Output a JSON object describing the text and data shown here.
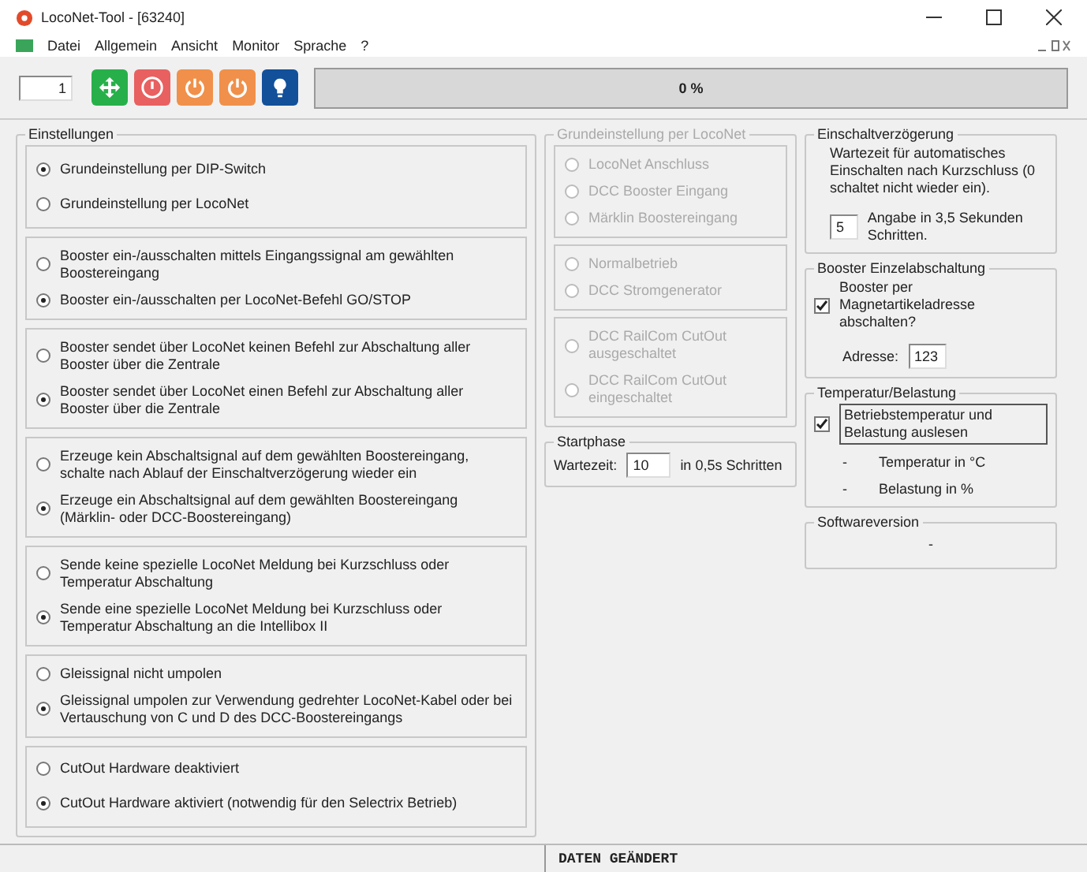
{
  "window": {
    "title": "LocoNet-Tool - [63240]"
  },
  "menu": [
    "Datei",
    "Allgemein",
    "Ansicht",
    "Monitor",
    "Sprache",
    "?"
  ],
  "toolbar": {
    "address": "1",
    "buttons": [
      {
        "kind": "connect"
      },
      {
        "kind": "stop"
      },
      {
        "kind": "power"
      },
      {
        "kind": "power"
      },
      {
        "kind": "light"
      }
    ],
    "progress": {
      "label": "0 %",
      "level": 0
    }
  },
  "settings": {
    "title": "Einstellungen",
    "groups": [
      {
        "options": [
          {
            "label": "Grundeinstellung per DIP-Switch",
            "selected": true
          },
          {
            "label": "Grundeinstellung per LocoNet",
            "selected": false
          }
        ]
      },
      {
        "options": [
          {
            "label": "Booster ein-/ausschalten mittels Eingangssignal am gewählten Boostereingang",
            "selected": false
          },
          {
            "label": "Booster ein-/ausschalten per LocoNet-Befehl GO/STOP",
            "selected": true
          }
        ]
      },
      {
        "options": [
          {
            "label": "Booster sendet über LocoNet keinen Befehl zur Abschaltung aller Booster über die Zentrale",
            "selected": false
          },
          {
            "label": "Booster sendet über LocoNet einen Befehl zur Abschaltung aller Booster über die Zentrale",
            "selected": true
          }
        ]
      },
      {
        "options": [
          {
            "label": "Erzeuge kein Abschaltsignal auf dem gewählten Boostereingang, schalte nach Ablauf der Einschaltverzögerung wieder ein",
            "selected": false
          },
          {
            "label": "Erzeuge ein Abschaltsignal auf dem gewählten Boostereingang (Märklin- oder DCC-Boostereingang)",
            "selected": true
          }
        ]
      },
      {
        "options": [
          {
            "label": "Sende keine spezielle LocoNet Meldung bei Kurzschluss oder Temperatur Abschaltung",
            "selected": false
          },
          {
            "label": "Sende eine spezielle LocoNet Meldung bei Kurzschluss oder Temperatur Abschaltung an die Intellibox II",
            "selected": true
          }
        ]
      },
      {
        "options": [
          {
            "label": "Gleissignal nicht umpolen",
            "selected": false
          },
          {
            "label": "Gleissignal umpolen zur Verwendung gedrehter LocoNet-Kabel oder bei Vertauschung von C und D des DCC-Boostereingangs",
            "selected": true
          }
        ]
      },
      {
        "options": [
          {
            "label": "CutOut Hardware deaktiviert",
            "selected": false
          },
          {
            "label": "CutOut Hardware aktiviert (notwendig für den Selectrix Betrieb)",
            "selected": true
          }
        ]
      }
    ]
  },
  "loconet_defaults": {
    "title": "Grundeinstellung per LocoNet",
    "disabled": true,
    "groups": [
      {
        "options": [
          {
            "label": "LocoNet Anschluss",
            "selected": false
          },
          {
            "label": "DCC Booster Eingang",
            "selected": false
          },
          {
            "label": "Märklin Boostereingang",
            "selected": false
          }
        ]
      },
      {
        "options": [
          {
            "label": "Normalbetrieb",
            "selected": false
          },
          {
            "label": "DCC Stromgenerator",
            "selected": false
          }
        ]
      },
      {
        "options": [
          {
            "label": "DCC RailCom CutOut ausgeschaltet",
            "selected": false
          },
          {
            "label": "DCC RailCom CutOut eingeschaltet",
            "selected": false
          }
        ]
      }
    ]
  },
  "start_phase": {
    "title": "Startphase",
    "label": "Wartezeit:",
    "value": "10",
    "unit": "in 0,5s Schritten"
  },
  "switch_on_delay": {
    "title": "Einschaltverzögerung",
    "description": "Wartezeit für automatisches Einschalten nach Kurzschluss (0 schaltet nicht wieder ein).",
    "value": "5",
    "unit": "Angabe in 3,5 Sekunden Schritten."
  },
  "booster_shutdown": {
    "title": "Booster Einzelabschaltung",
    "checkbox": {
      "label": "Booster per Magnetartikeladresse abschalten?",
      "checked": true
    },
    "address_label": "Adresse:",
    "address": "123"
  },
  "temperature": {
    "title": "Temperatur/Belastung",
    "checkbox": {
      "label": "Betriebstemperatur und Belastung auslesen",
      "checked": true
    },
    "readings": [
      {
        "value": "-",
        "label": "Temperatur in °C"
      },
      {
        "value": "-",
        "label": "Belastung in %"
      }
    ]
  },
  "software": {
    "title": "Softwareversion",
    "value": "-"
  },
  "status_bar": [
    "DATEN GEÄNDERT"
  ]
}
